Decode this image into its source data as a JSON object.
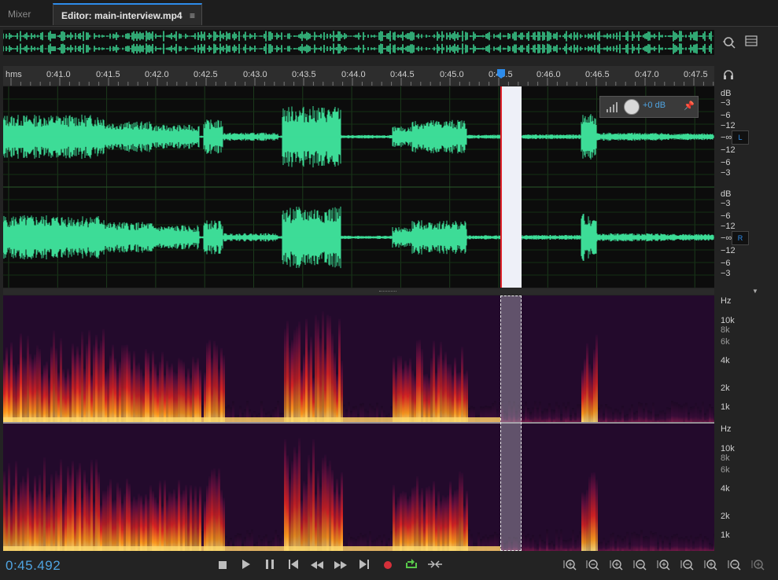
{
  "tabs": {
    "mixer": "Mixer",
    "editor": "Editor: main-interview.mp4",
    "editor_menu": "≡"
  },
  "ruler": {
    "unit": "hms",
    "labels": [
      "0:41.0",
      "0:41.5",
      "0:42.0",
      "0:42.5",
      "0:43.0",
      "0:43.5",
      "0:44.0",
      "0:44.5",
      "0:45.0",
      "0:45.5",
      "0:46.0",
      "0:46.5",
      "0:47.0",
      "0:47.5"
    ]
  },
  "amplitude_scale": {
    "top_channel": [
      "dB",
      "−3",
      "−6",
      "−12",
      "−∞",
      "−12",
      "−6",
      "−3"
    ],
    "bottom_channel": [
      "dB",
      "−3",
      "−6",
      "−12",
      "−∞",
      "−12",
      "−6",
      "−3"
    ]
  },
  "channels": {
    "left": "L",
    "right": "R"
  },
  "gain_hud": {
    "value": "+0 dB"
  },
  "frequency_scale": {
    "labels": [
      "Hz",
      "10k",
      "8k",
      "6k",
      "4k",
      "2k",
      "1k"
    ]
  },
  "timecode": "0:45.492",
  "colors": {
    "waveform": "#3ddc97",
    "accent": "#2d8ceb",
    "selection_edge": "#e0242c",
    "timecode": "#4fa3e0"
  },
  "icons": {
    "transport": [
      "stop-icon",
      "play-icon",
      "pause-icon",
      "skip-to-start-icon",
      "rewind-icon",
      "fast-forward-icon",
      "skip-to-end-icon",
      "record-icon",
      "loop-icon",
      "skip-selection-icon"
    ],
    "zoom": [
      "zoom-in-amplitude-icon",
      "zoom-out-amplitude-icon",
      "zoom-in-time-icon",
      "zoom-out-time-icon",
      "zoom-out-full-icon",
      "zoom-in-at-start-icon",
      "zoom-in-at-end-icon",
      "zoom-in-center-icon",
      "zoom-selection-icon"
    ]
  }
}
